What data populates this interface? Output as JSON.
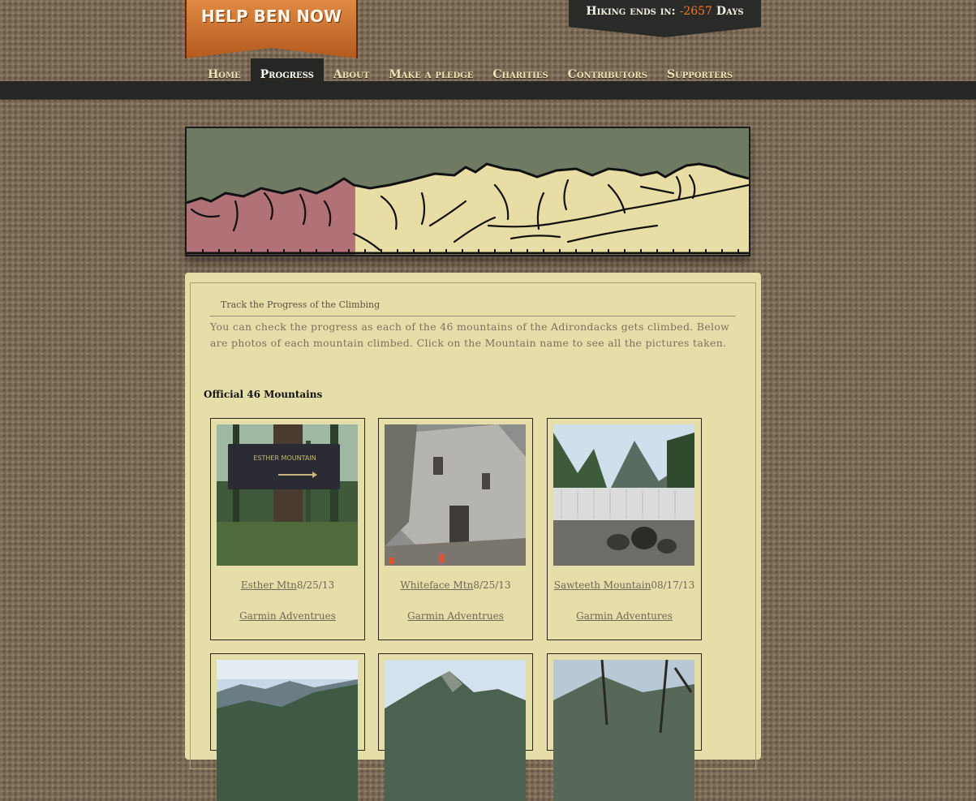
{
  "header": {
    "logo_text": "HELP BEN NOW",
    "countdown_label": "Hiking ends in:",
    "countdown_value": "-2657",
    "countdown_unit": "Days"
  },
  "nav": {
    "items": [
      "Home",
      "Progress",
      "About",
      "Make a pledge",
      "Charities",
      "Contributors",
      "Supporters"
    ],
    "active": "Progress"
  },
  "banner": {
    "progress_fraction": 0.3
  },
  "main": {
    "section_title": "Track the Progress of the Climbing",
    "intro": "You can check the progress as each of the 46 mountains of the Adirondacks gets climbed. Below are photos of each mountain climbed. Click on the Mountain name to see all the pictures taken.",
    "list_heading": "Official 46 Mountains",
    "cards": [
      {
        "name": "Esther Mtn",
        "date": "8/25/13",
        "link": "Garmin Adventrues"
      },
      {
        "name": "Whiteface Mtn",
        "date": "8/25/13",
        "link": "Garmin Adventrues"
      },
      {
        "name": "Sawteeth Mountain",
        "date": "08/17/13",
        "link": "Garmin Adventures"
      }
    ]
  },
  "colors": {
    "accent_orange": "#f07a2c",
    "climbed": "#b07276",
    "remaining": "#e8dda4",
    "panel": "#e6dea9"
  }
}
